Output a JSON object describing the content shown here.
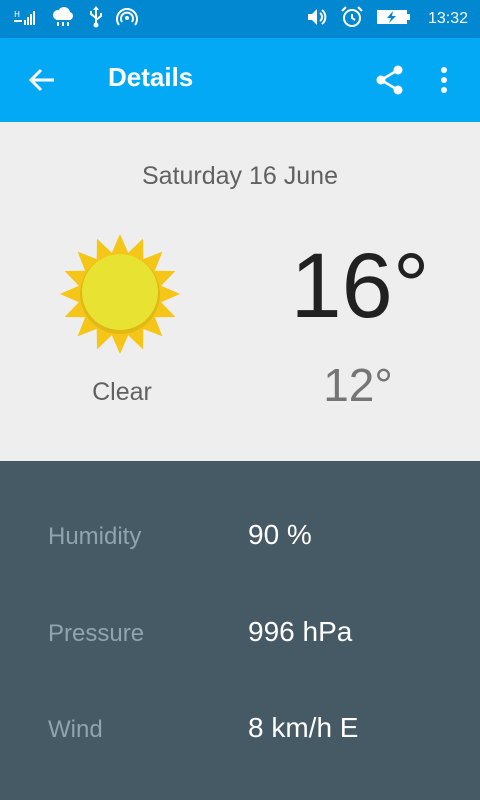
{
  "status_bar": {
    "time": "13:32",
    "icons": [
      "signal-icon",
      "cloud-rain-icon",
      "usb-icon",
      "hotspot-icon",
      "volume-icon",
      "alarm-icon",
      "battery-charging-icon"
    ]
  },
  "app_bar": {
    "title": "Details",
    "back_icon": "arrow-left-icon",
    "share_icon": "share-icon",
    "more_icon": "more-vert-icon",
    "color": "#03a9f4"
  },
  "forecast": {
    "date": "Saturday 16 June",
    "condition": "Clear",
    "high": "16°",
    "low": "12°",
    "icon": "sun-icon"
  },
  "details": [
    {
      "label": "Humidity",
      "value": "90 %"
    },
    {
      "label": "Pressure",
      "value": "996 hPa"
    },
    {
      "label": "Wind",
      "value": "8 km/h E"
    }
  ],
  "colors": {
    "status_bar": "#0288d1",
    "app_bar": "#03a9f4",
    "top_background": "#eeeeee",
    "detail_background": "#455a64",
    "sun": "#e8e233"
  }
}
